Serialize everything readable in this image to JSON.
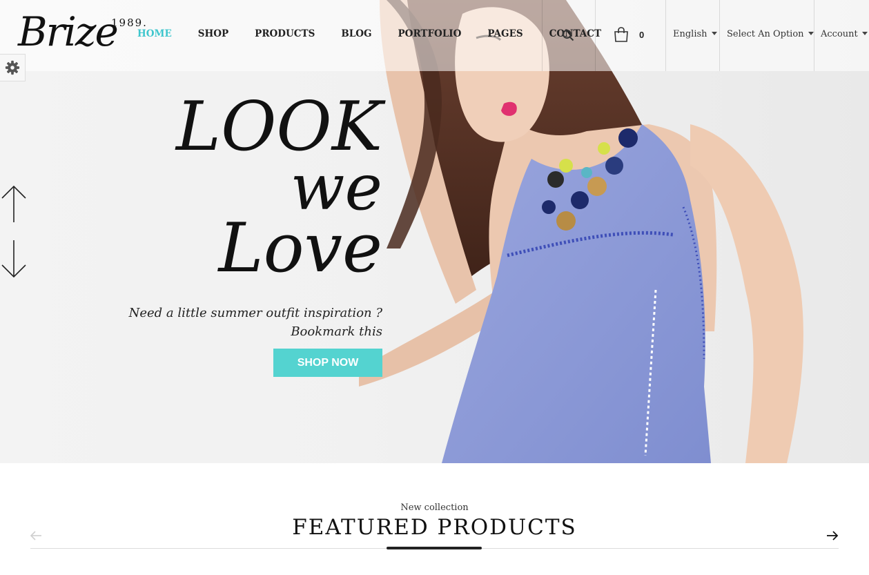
{
  "header": {
    "logo_text": "Brize",
    "logo_year": "1989.",
    "nav": [
      {
        "label": "HOME",
        "active": true
      },
      {
        "label": "SHOP",
        "active": false
      },
      {
        "label": "PRODUCTS",
        "active": false
      },
      {
        "label": "BLOG",
        "active": false
      },
      {
        "label": "PORTFOLIO",
        "active": false
      },
      {
        "label": "PAGES",
        "active": false
      },
      {
        "label": "CONTACT",
        "active": false
      }
    ],
    "cart_count": "0",
    "language": "English",
    "select_option": "Select An Option",
    "account": "Account"
  },
  "hero": {
    "title_line1": "LOOK",
    "title_line2": "we",
    "title_line3": "Love",
    "subtitle_line1": "Need a little summer outfit inspiration ?",
    "subtitle_line2": "Bookmark this",
    "cta_label": "SHOP NOW"
  },
  "featured": {
    "kicker": "New collection",
    "title": "FEATURED PRODUCTS"
  },
  "colors": {
    "accent": "#3fc6cd",
    "button": "#54d3d0",
    "dress": "#8d9bd8",
    "hair": "#5a3426"
  },
  "icons": [
    "search-icon",
    "cart-icon",
    "gear-icon",
    "arrow-up-icon",
    "arrow-down-icon",
    "arrow-left-icon",
    "arrow-right-icon"
  ]
}
